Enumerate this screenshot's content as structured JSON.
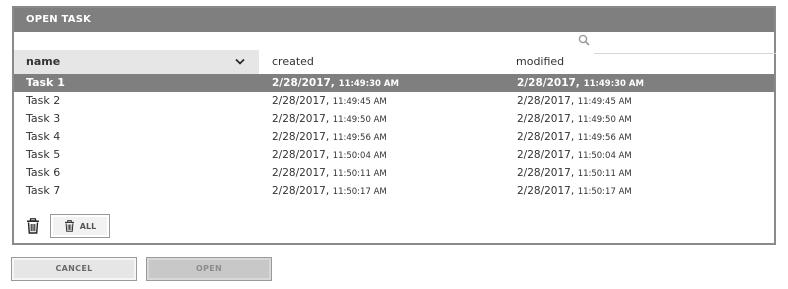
{
  "dialog": {
    "title": "OPEN TASK",
    "search": {
      "value": "",
      "placeholder": ""
    }
  },
  "table": {
    "headers": {
      "name": "name",
      "created": "created",
      "modified": "modified"
    },
    "rows": [
      {
        "name": "Task 1",
        "created_date": "2/28/2017,",
        "created_time": "11:49:30 AM",
        "modified_date": "2/28/2017,",
        "modified_time": "11:49:30 AM",
        "selected": true
      },
      {
        "name": "Task 2",
        "created_date": "2/28/2017,",
        "created_time": "11:49:45 AM",
        "modified_date": "2/28/2017,",
        "modified_time": "11:49:45 AM",
        "selected": false
      },
      {
        "name": "Task 3",
        "created_date": "2/28/2017,",
        "created_time": "11:49:50 AM",
        "modified_date": "2/28/2017,",
        "modified_time": "11:49:50 AM",
        "selected": false
      },
      {
        "name": "Task 4",
        "created_date": "2/28/2017,",
        "created_time": "11:49:56 AM",
        "modified_date": "2/28/2017,",
        "modified_time": "11:49:56 AM",
        "selected": false
      },
      {
        "name": "Task 5",
        "created_date": "2/28/2017,",
        "created_time": "11:50:04 AM",
        "modified_date": "2/28/2017,",
        "modified_time": "11:50:04 AM",
        "selected": false
      },
      {
        "name": "Task 6",
        "created_date": "2/28/2017,",
        "created_time": "11:50:11 AM",
        "modified_date": "2/28/2017,",
        "modified_time": "11:50:11 AM",
        "selected": false
      },
      {
        "name": "Task 7",
        "created_date": "2/28/2017,",
        "created_time": "11:50:17 AM",
        "modified_date": "2/28/2017,",
        "modified_time": "11:50:17 AM",
        "selected": false
      }
    ]
  },
  "actions": {
    "delete_all_label": "ALL"
  },
  "footer": {
    "cancel_label": "CANCEL",
    "open_label": "OPEN"
  },
  "icons": {
    "search": "search-icon",
    "sort": "chevron-down-icon",
    "delete": "trash-icon"
  },
  "colors": {
    "title_bar": "#7f7f7f",
    "selected_row": "#7f7f7f",
    "header_cell": "#e6e6e6"
  }
}
